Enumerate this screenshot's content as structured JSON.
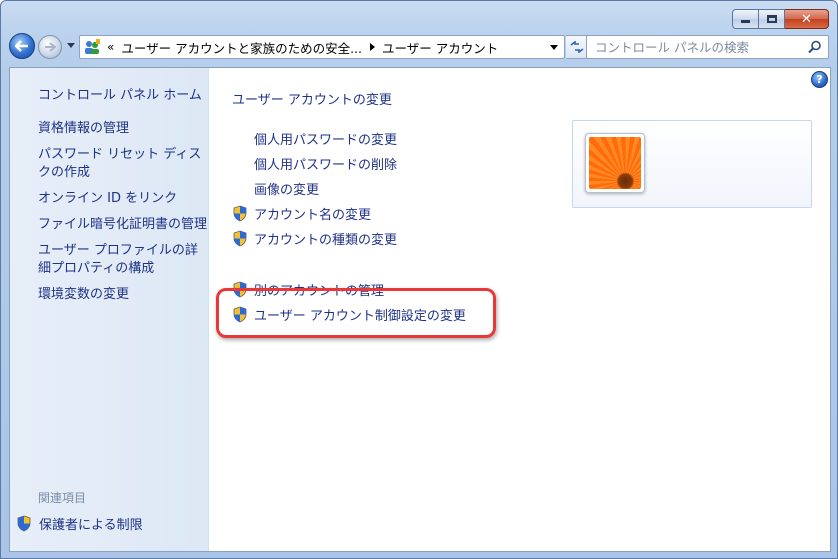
{
  "window": {
    "caption": {
      "minimize": "",
      "maximize": "",
      "close": "✕"
    }
  },
  "navbar": {
    "address": {
      "overflow": "«",
      "segment1": "ユーザー アカウントと家族のための安全...",
      "segment2": "ユーザー アカウント"
    },
    "search": {
      "placeholder": "コントロール パネルの検索"
    }
  },
  "sidebar": {
    "home": "コントロール パネル ホーム",
    "items": [
      {
        "label": "資格情報の管理"
      },
      {
        "label": "パスワード リセット ディスクの作成"
      },
      {
        "label": "オンライン ID をリンク"
      },
      {
        "label": "ファイル暗号化証明書の管理"
      },
      {
        "label": "ユーザー プロファイルの詳細プロパティの構成"
      },
      {
        "label": "環境変数の変更"
      }
    ],
    "related_title": "関連項目",
    "related_link": "保護者による制限"
  },
  "main": {
    "title": "ユーザー アカウントの変更",
    "links": {
      "password_change": "個人用パスワードの変更",
      "password_remove": "個人用パスワードの削除",
      "picture_change": "画像の変更",
      "name_change": "アカウント名の変更",
      "type_change": "アカウントの種類の変更",
      "manage_other": "別のアカウントの管理",
      "uac_settings": "ユーザー アカウント制御設定の変更"
    },
    "help": "?"
  },
  "colors": {
    "link": "#1e3287",
    "highlight": "#e83838",
    "sidebar_bg": "#e3ebf6"
  }
}
